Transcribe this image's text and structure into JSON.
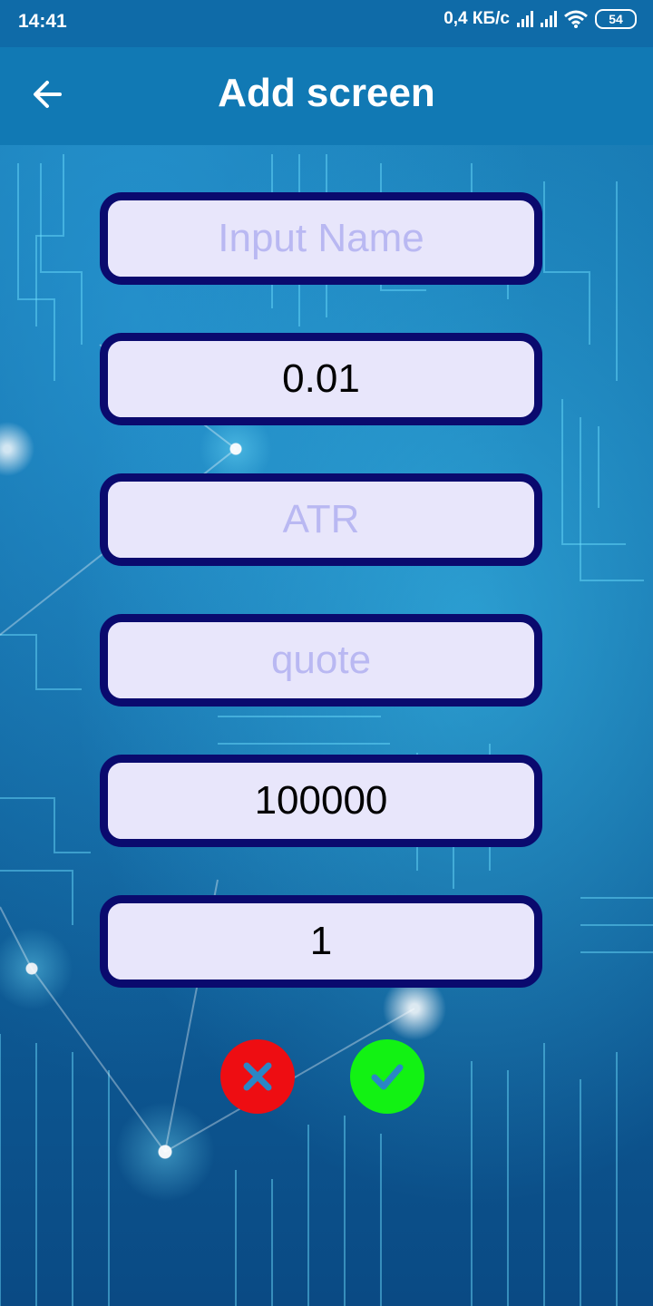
{
  "status_bar": {
    "time": "14:41",
    "network_speed": "0,4 КБ/с",
    "battery": "54"
  },
  "app_bar": {
    "title": "Add screen",
    "back_icon": "arrow-left-icon"
  },
  "form": {
    "fields": [
      {
        "name": "name",
        "placeholder": "Input Name",
        "value": ""
      },
      {
        "name": "step",
        "placeholder": "",
        "value": "0.01"
      },
      {
        "name": "atr",
        "placeholder": "ATR",
        "value": ""
      },
      {
        "name": "quote",
        "placeholder": "quote",
        "value": ""
      },
      {
        "name": "amount",
        "placeholder": "",
        "value": "100000"
      },
      {
        "name": "count",
        "placeholder": "",
        "value": "1"
      }
    ]
  },
  "actions": {
    "cancel_icon": "close-icon",
    "confirm_icon": "check-icon",
    "cancel_color": "#ee0d12",
    "confirm_color": "#12f213"
  },
  "colors": {
    "app_bar": "#1179b4",
    "field_border": "#0a0a6e",
    "field_fill": "#e8e6fb",
    "placeholder": "#b9b8f2"
  }
}
